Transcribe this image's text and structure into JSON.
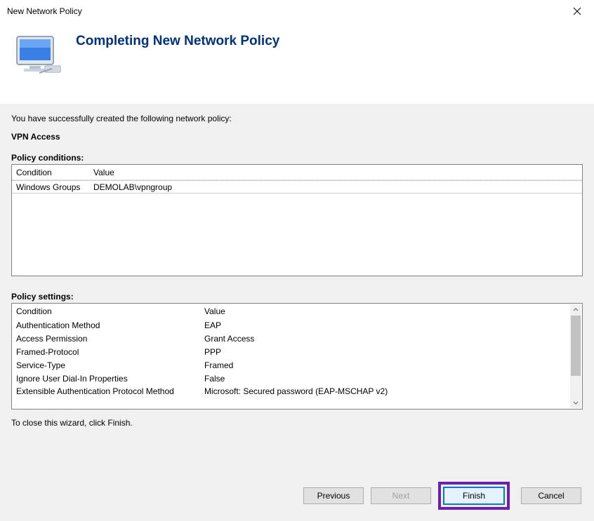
{
  "window": {
    "title": "New Network Policy"
  },
  "header": {
    "title": "Completing New Network Policy"
  },
  "body": {
    "intro": "You have successfully created the following network policy:",
    "policy_name": "VPN Access",
    "conditions_label": "Policy conditions:",
    "settings_label": "Policy settings:",
    "footer": "To close this wizard, click Finish."
  },
  "conditions": {
    "headers": {
      "c1": "Condition",
      "c2": "Value"
    },
    "rows": [
      {
        "c1": "Windows Groups",
        "c2": "DEMOLAB\\vpngroup"
      }
    ]
  },
  "settings": {
    "headers": {
      "c1": "Condition",
      "c2": "Value"
    },
    "rows": [
      {
        "c1": "Authentication Method",
        "c2": "EAP"
      },
      {
        "c1": "Access Permission",
        "c2": "Grant Access"
      },
      {
        "c1": "Framed-Protocol",
        "c2": "PPP"
      },
      {
        "c1": "Service-Type",
        "c2": "Framed"
      },
      {
        "c1": "Ignore User Dial-In Properties",
        "c2": "False"
      },
      {
        "c1": "Extensible Authentication Protocol Method",
        "c2": "Microsoft: Secured password (EAP-MSCHAP v2)"
      }
    ]
  },
  "buttons": {
    "previous": "Previous",
    "next": "Next",
    "finish": "Finish",
    "cancel": "Cancel"
  }
}
